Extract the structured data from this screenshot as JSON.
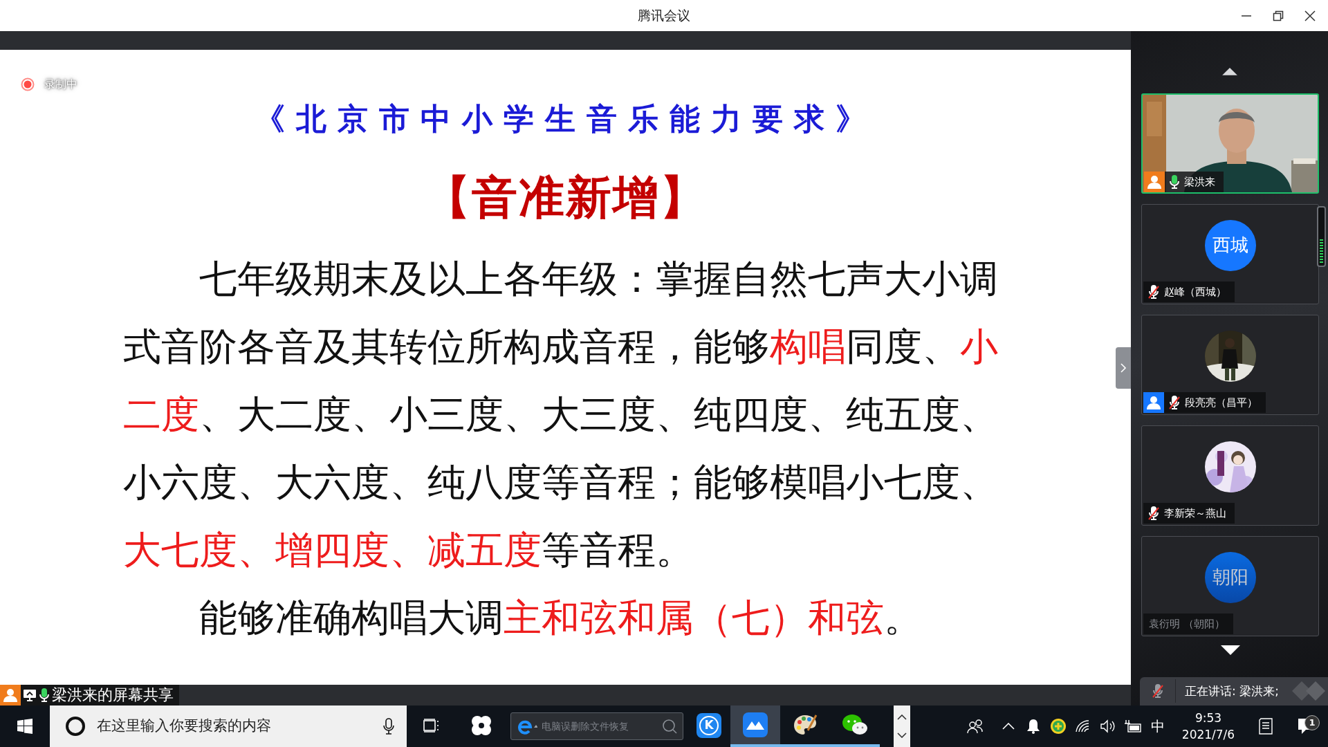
{
  "window": {
    "title": "腾讯会议"
  },
  "recording": {
    "label": "录制中"
  },
  "slide": {
    "title": "《北京市中小学生音乐能力要求》",
    "subtitle": "【音准新增】",
    "paragraphs": [
      {
        "segments": [
          {
            "text": "七年级期末及以上各年级：掌握自然七声大小调式音阶各音及其转位所构成音程，能够",
            "emphasis": false
          },
          {
            "text": "构唱",
            "emphasis": true
          },
          {
            "text": "同度、",
            "emphasis": false
          },
          {
            "text": "小二度",
            "emphasis": true
          },
          {
            "text": "、大二度、小三度、大三度、纯四度、纯五度、小六度、大六度、纯八度等音程；能够模唱小七度、",
            "emphasis": false
          },
          {
            "text": "大七度、增四度、减五度",
            "emphasis": true
          },
          {
            "text": "等音程。",
            "emphasis": false
          }
        ]
      },
      {
        "segments": [
          {
            "text": "能够准确构唱大调",
            "emphasis": false
          },
          {
            "text": "主和弦和属（七）和弦",
            "emphasis": true
          },
          {
            "text": "。",
            "emphasis": false
          }
        ]
      }
    ]
  },
  "screen_share": {
    "label": "梁洪来的屏幕共享",
    "muted": false
  },
  "participants": [
    {
      "name": "梁洪来",
      "kind": "video",
      "badge": {
        "color": "#f07c1c"
      },
      "muted": false,
      "speaking": true,
      "dimmed": false
    },
    {
      "name": "赵峰（西城）",
      "kind": "initials",
      "initials": "西城",
      "muted": true,
      "speaking": false,
      "dimmed": false
    },
    {
      "name": "段亮亮（昌平）",
      "kind": "picture",
      "badge": {
        "color": "#1677ff"
      },
      "muted": true,
      "speaking": false,
      "dimmed": false
    },
    {
      "name": "李新荣～燕山",
      "kind": "picture",
      "muted": true,
      "speaking": false,
      "dimmed": false
    },
    {
      "name": "袁衍明 （朝阳）",
      "kind": "initials",
      "initials": "朝阳",
      "speaking": false,
      "dimmed": true
    }
  ],
  "volume_meter": {
    "level": 0.45
  },
  "speaking_bar": {
    "text": "正在讲话: 梁洪来;",
    "muted": true
  },
  "taskbar": {
    "search": {
      "placeholder": "在这里输入你要搜索的内容"
    },
    "apps": [
      {
        "kind": "fan",
        "running": false,
        "selected": false
      },
      {
        "kind": "searchbox",
        "placeholder": "电脑误删除文件恢复"
      },
      {
        "kind": "k",
        "label": "K",
        "running": false,
        "selected": false
      },
      {
        "kind": "meeting",
        "running": true,
        "selected": true
      },
      {
        "kind": "paint",
        "running": true,
        "selected": false
      },
      {
        "kind": "wechat",
        "running": true,
        "selected": false
      }
    ],
    "ime": "中",
    "time": "9:53",
    "date": "2021/7/6",
    "notification_count": "1"
  }
}
